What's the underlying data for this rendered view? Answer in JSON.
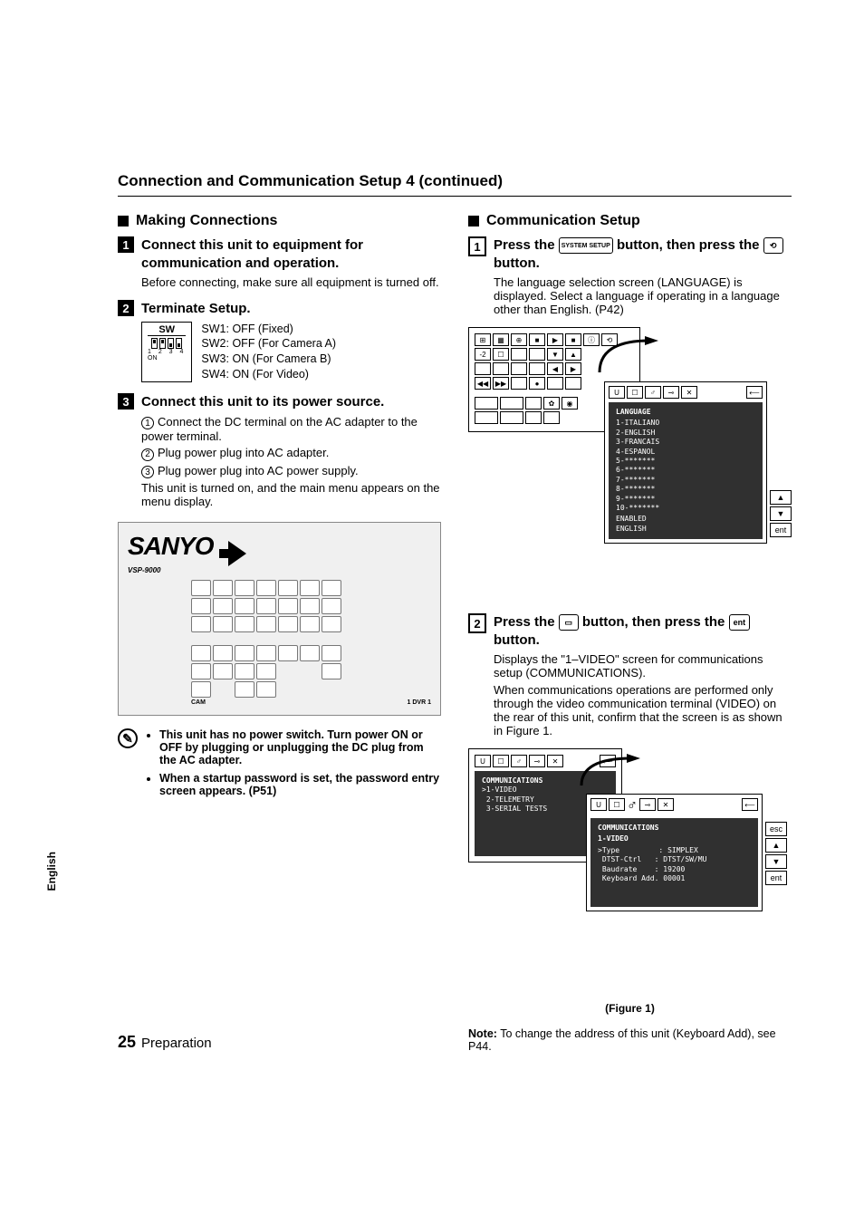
{
  "heading": "Connection and Communication Setup 4  (continued)",
  "left": {
    "section": "Making Connections",
    "step1": {
      "num": "1",
      "title": "Connect this unit to equipment for communication and operation.",
      "text": "Before connecting, make sure all equipment is turned off."
    },
    "step2": {
      "num": "2",
      "title": "Terminate Setup.",
      "sw_label": "SW",
      "sw_nums": "1 2 3 4",
      "sw_on": "ON",
      "lines": {
        "l1": "SW1: OFF (Fixed)",
        "l2": "SW2: OFF (For Camera A)",
        "l3": "SW3: ON (For Camera B)",
        "l4": "SW4: ON (For Video)"
      }
    },
    "step3": {
      "num": "3",
      "title": "Connect this unit to its power source.",
      "sub1": "Connect the DC terminal on the AC adapter to the power terminal.",
      "sub2": "Plug power plug into AC adapter.",
      "sub3": "Plug power plug into AC power supply.",
      "tail": "This unit is turned on, and the main menu appears on the menu display."
    },
    "device": {
      "logo": "SANYO",
      "model": "VSP-9000",
      "cam_label": "CAM",
      "dvr_label": "1  DVR      1"
    },
    "note": {
      "b1": "This unit has no power switch. Turn power ON or OFF by plugging or unplugging the DC plug from the AC adapter.",
      "b2": "When a startup password is set, the password entry screen appears. (P51)"
    }
  },
  "right": {
    "section": "Communication Setup",
    "step1": {
      "num": "1",
      "pre": "Press the ",
      "btn1": "SYSTEM SETUP",
      "mid": " button, then press the ",
      "btn2": "⟲",
      "post": " button.",
      "text": "The language selection screen (LANGUAGE) is displayed. Select a language if operating in a language other than English. (P42)"
    },
    "screen1": {
      "title": "LANGUAGE",
      "items": "1-ITALIANO\n2-ENGLISH\n3-FRANCAIS\n4-ESPANOL\n5-*******\n6-*******\n7-*******\n8-*******\n9-*******\n10-*******",
      "enabled": "ENABLED\nENGLISH",
      "side_up": "▲",
      "side_dn": "▼",
      "side_ent": "ent"
    },
    "step2": {
      "num": "2",
      "pre": "Press the ",
      "btn1": "☐",
      "mid": " button, then press the ",
      "btn2": "ent",
      "post": " button.",
      "text1": "Displays the \"1–VIDEO\" screen for communications setup (COMMUNICATIONS).",
      "text2": "When communications operations are performed only through the video communication terminal (VIDEO) on the rear of this unit, confirm that the screen is as shown in Figure 1."
    },
    "screen2": {
      "outer_title": "COMMUNICATIONS",
      "outer_items": ">1-VIDEO\n 2-TELEMETRY\n 3-SERIAL TESTS",
      "inner_title": "COMMUNICATIONS",
      "inner_sub": "1-VIDEO",
      "inner_body": ">Type         : SIMPLEX\n DTST-Ctrl   : DTST/SW/MU\n Baudrate    : 19200\n Keyboard Add. 00001",
      "side_esc": "esc",
      "side_up": "▲",
      "side_dn": "▼",
      "side_ent": "ent",
      "caption": "(Figure 1)"
    },
    "note": {
      "label": "Note:",
      "text": "To change the address of this unit (Keyboard Add), see P44."
    }
  },
  "side_label": "English",
  "footer_num": "25",
  "footer_text": "Preparation"
}
